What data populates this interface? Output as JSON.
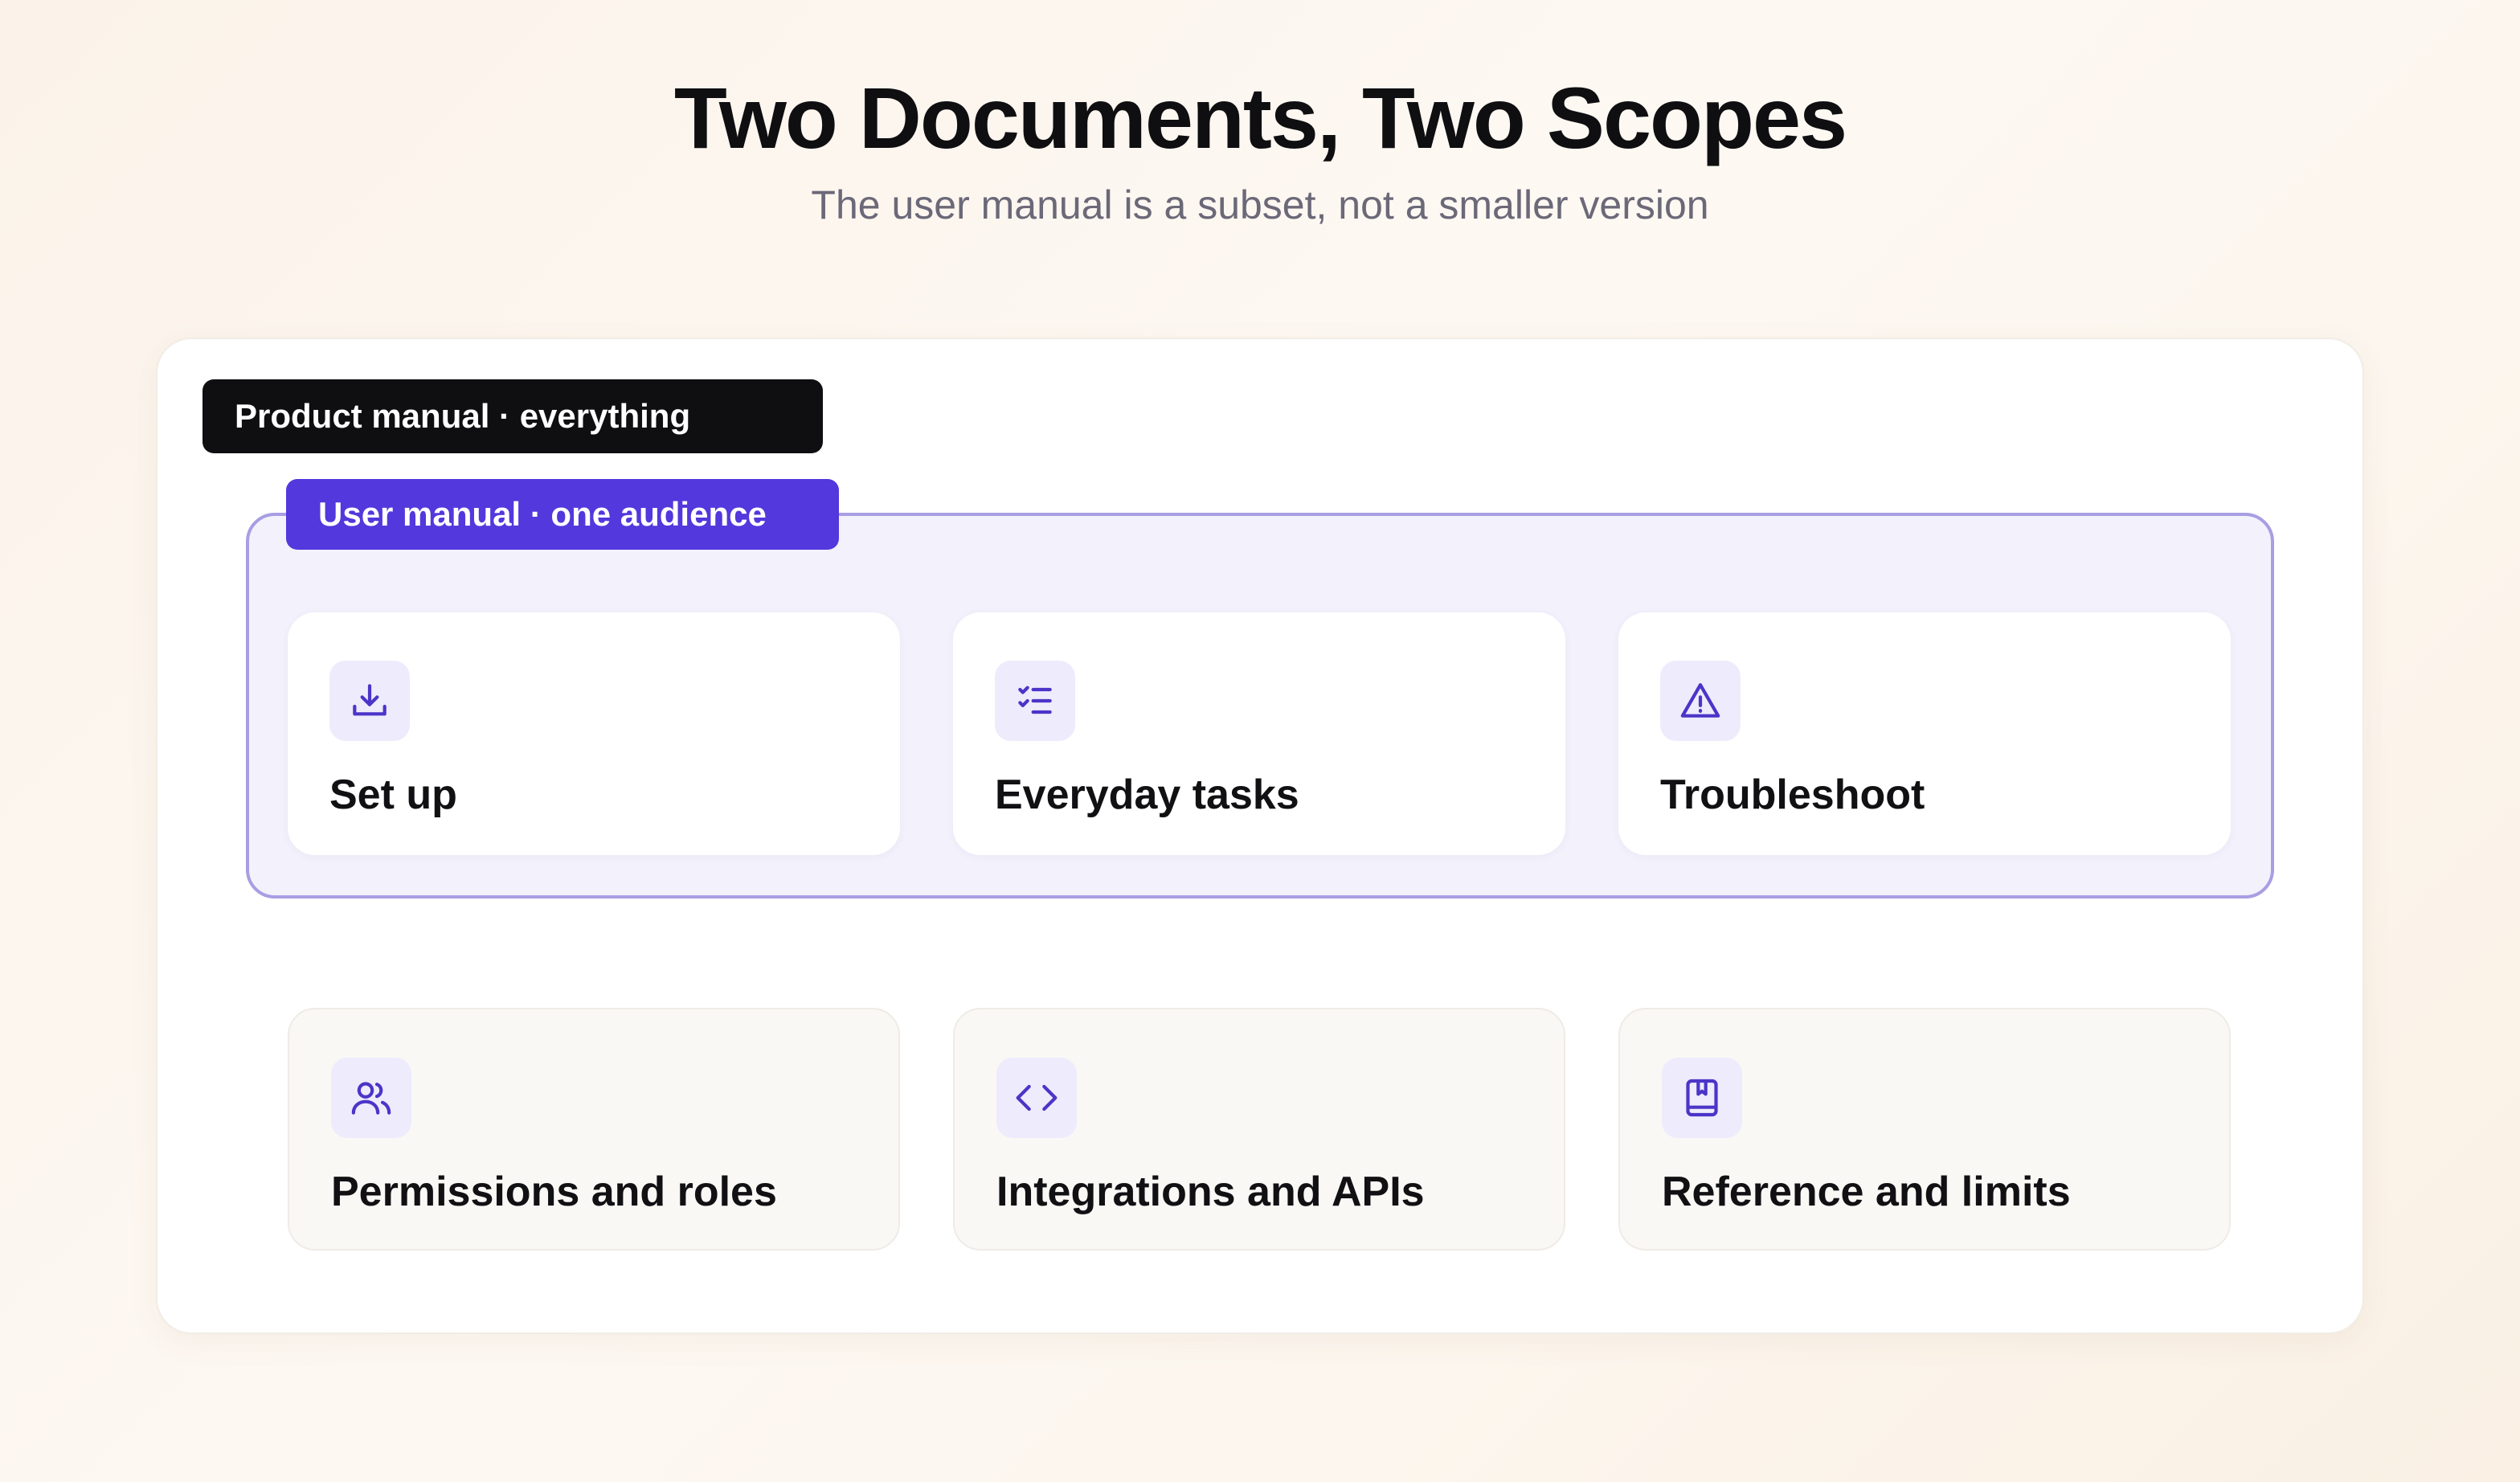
{
  "header": {
    "title": "Two Documents, Two Scopes",
    "subtitle": "The user manual is a subset, not a smaller version"
  },
  "product_manual": {
    "tag": "Product manual · everything"
  },
  "user_manual": {
    "tag": "User manual · one audience",
    "cards": [
      {
        "label": "Set up",
        "icon": "download-icon"
      },
      {
        "label": "Everyday tasks",
        "icon": "checklist-icon"
      },
      {
        "label": "Troubleshoot",
        "icon": "warning-icon"
      }
    ]
  },
  "outside_cards": [
    {
      "label": "Permissions and roles",
      "icon": "users-icon"
    },
    {
      "label": "Integrations and APIs",
      "icon": "code-icon"
    },
    {
      "label": "Reference and limits",
      "icon": "book-icon"
    }
  ],
  "colors": {
    "accent": "#5238dd",
    "accent_border": "#a79ee3",
    "dark_tag": "#0f0f12"
  }
}
